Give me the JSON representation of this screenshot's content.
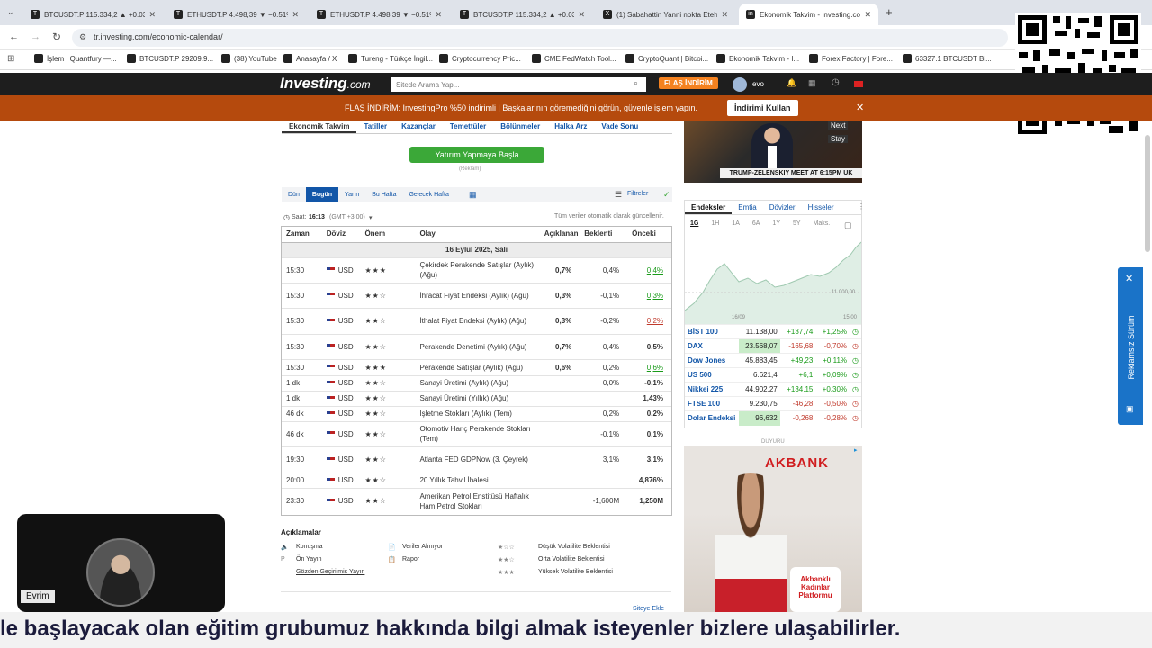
{
  "browser": {
    "tabs": [
      {
        "label": "BTCUSDT.P 115.334,2 ▲ +0.03%"
      },
      {
        "label": "ETHUSDT.P 4.498,39 ▼ −0.51%"
      },
      {
        "label": "ETHUSDT.P 4.498,39 ▼ −0.51%"
      },
      {
        "label": "BTCUSDT.P 115.334,2 ▲ +0.03%"
      },
      {
        "label": "(1) Sabahattin Yanni nokta Eteh"
      },
      {
        "label": "Ekonomik Takvim - Investing.com"
      }
    ],
    "new_tab": "+",
    "url": "tr.investing.com/economic-calendar/",
    "bookmarks": [
      "İşlem | Quantfury —...",
      "BTCUSDT.P 29209.9...",
      "(38) YouTube",
      "Anasayfa / X",
      "Tureng - Türkçe İngil...",
      "Cryptocurrency Pric...",
      "CME FedWatch Tool...",
      "CryptoQuant | Bitcoi...",
      "Ekonomik Takvim - I...",
      "Forex Factory | Fore...",
      "63327.1 BTCUSDT Bi..."
    ]
  },
  "site": {
    "logo": "Investing",
    "logo_suffix": ".com",
    "search_placeholder": "Sitede Arama Yap...",
    "flash_button": "FLAŞ İNDİRİM",
    "user": "evo",
    "promo_text": "FLAŞ İNDİRİM: InvestingPro %50 indirimli | Başkalarının göremediğini görün, güvenle işlem yapın.",
    "promo_button": "İndirimi Kullan",
    "tabs": [
      "Ekonomik Takvim",
      "Tatiller",
      "Kazançlar",
      "Temettüler",
      "Bölünmeler",
      "Halka Arz",
      "Vade Sonu"
    ],
    "invest_button": "Yatırım Yapmaya Başla",
    "ad_label": "(Reklam)",
    "day_tabs": [
      "Dün",
      "Bugün",
      "Yarın",
      "Bu Hafta",
      "Gelecek Hafta"
    ],
    "filters": "Filtreler",
    "time_label": "Saat:",
    "time_value": "16:13",
    "timezone": "(GMT +3:00)",
    "auto_update": "Tüm veriler otomatik olarak güncellenir.",
    "columns": [
      "Zaman",
      "Döviz",
      "Önem",
      "Olay",
      "Açıklanan",
      "Beklenti",
      "Önceki"
    ],
    "date_row": "16 Eylül 2025, Salı",
    "events": [
      {
        "time": "15:30",
        "cur": "USD",
        "stars": 3,
        "event": "Çekirdek Perakende Satışlar (Aylık) (Ağu)",
        "actual": "0,7%",
        "actual_cls": "grn",
        "forecast": "0,4%",
        "previous": "0,4%",
        "prev_cls": "grn",
        "h": 28
      },
      {
        "time": "15:30",
        "cur": "USD",
        "stars": 2,
        "event": "İhracat Fiyat Endeksi (Aylık) (Ağu)",
        "actual": "0,3%",
        "actual_cls": "grn",
        "forecast": "-0,1%",
        "previous": "0,3%",
        "prev_cls": "grn",
        "h": 28
      },
      {
        "time": "15:30",
        "cur": "USD",
        "stars": 2,
        "event": "İthalat Fiyat Endeksi (Aylık) (Ağu)",
        "actual": "0,3%",
        "actual_cls": "grn",
        "forecast": "-0,2%",
        "previous": "0,2%",
        "prev_cls": "red",
        "h": 29
      },
      {
        "time": "15:30",
        "cur": "USD",
        "stars": 2,
        "event": "Perakende Denetimi (Aylık) (Ağu)",
        "actual": "0,7%",
        "actual_cls": "grn",
        "forecast": "0,4%",
        "previous": "0,5%",
        "prev_cls": "",
        "h": 28
      },
      {
        "time": "15:30",
        "cur": "USD",
        "stars": 3,
        "event": "Perakende Satışlar (Aylık) (Ağu)",
        "actual": "0,6%",
        "actual_cls": "grn",
        "forecast": "0,2%",
        "previous": "0,6%",
        "prev_cls": "grn",
        "h": 18
      },
      {
        "time": "1 dk",
        "cur": "USD",
        "stars": 2,
        "event": "Sanayi Üretimi (Aylık) (Ağu)",
        "actual": "",
        "actual_cls": "",
        "forecast": "0,0%",
        "previous": "-0,1%",
        "prev_cls": "",
        "h": 17
      },
      {
        "time": "1 dk",
        "cur": "USD",
        "stars": 2,
        "event": "Sanayi Üretimi (Yıllık) (Ağu)",
        "actual": "",
        "actual_cls": "",
        "forecast": "",
        "previous": "1,43%",
        "prev_cls": "",
        "h": 17
      },
      {
        "time": "46 dk",
        "cur": "USD",
        "stars": 2,
        "event": "İşletme Stokları (Aylık) (Tem)",
        "actual": "",
        "actual_cls": "",
        "forecast": "0,2%",
        "previous": "0,2%",
        "prev_cls": "",
        "h": 17
      },
      {
        "time": "46 dk",
        "cur": "USD",
        "stars": 2,
        "event": "Otomotiv Hariç Perakende Stokları (Tem)",
        "actual": "",
        "actual_cls": "",
        "forecast": "-0,1%",
        "previous": "0,1%",
        "prev_cls": "",
        "h": 28
      },
      {
        "time": "19:30",
        "cur": "USD",
        "stars": 2,
        "event": "Atlanta FED GDPNow (3. Çeyrek)",
        "actual": "",
        "actual_cls": "",
        "forecast": "3,1%",
        "previous": "3,1%",
        "prev_cls": "",
        "h": 29
      },
      {
        "time": "20:00",
        "cur": "USD",
        "stars": 2,
        "event": "20 Yıllık Tahvil İhalesi",
        "actual": "",
        "actual_cls": "",
        "forecast": "",
        "previous": "4,876%",
        "prev_cls": "",
        "h": 17
      },
      {
        "time": "23:30",
        "cur": "USD",
        "stars": 2,
        "event": "Amerikan Petrol Enstitüsü Haftalık Ham Petrol Stokları",
        "actual": "",
        "actual_cls": "",
        "forecast": "-1,600M",
        "previous": "1,250M",
        "prev_cls": "",
        "h": 29
      }
    ],
    "notes_title": "Açıklamalar",
    "legend": [
      {
        "icon": "🔈",
        "text": "Konuşma"
      },
      {
        "icon": "P",
        "text": "Ön Yayın"
      },
      {
        "icon": "",
        "text": "Gözden Geçirilmiş Yayın"
      },
      {
        "icon": "📄",
        "text": "Veriler Alınıyor"
      },
      {
        "icon": "📋",
        "text": "Rapor"
      },
      {
        "icon": "★☆☆",
        "text": "Düşük Volatilite Beklentisi"
      },
      {
        "icon": "★★☆",
        "text": "Orta Volatilite Beklentisi"
      },
      {
        "icon": "★★★",
        "text": "Yüksek Volatilite Beklentisi"
      }
    ],
    "add_site": "Siteye Ekle"
  },
  "news": {
    "headline": "TRUMP-ZELENSKIY MEET AT 6:15PM UK",
    "next": "Next",
    "stay": "Stay"
  },
  "markets": {
    "tabs": [
      "Endeksler",
      "Emtia",
      "Dövizler",
      "Hisseler"
    ],
    "periods": [
      "1G",
      "1H",
      "1A",
      "6A",
      "1Y",
      "5Y",
      "Maks."
    ],
    "chart_label": "11.000,00",
    "x_labels": [
      "16/09",
      "15:00"
    ],
    "rows": [
      {
        "name": "BİST 100",
        "last": "11.138,00",
        "chg": "+137,74",
        "pct": "+1,25%",
        "up": true
      },
      {
        "name": "DAX",
        "last": "23.568,07",
        "chg": "-165,68",
        "pct": "-0,70%",
        "up": false
      },
      {
        "name": "Dow Jones",
        "last": "45.883,45",
        "chg": "+49,23",
        "pct": "+0,11%",
        "up": true
      },
      {
        "name": "US 500",
        "last": "6.621,4",
        "chg": "+6,1",
        "pct": "+0,09%",
        "up": true
      },
      {
        "name": "Nikkei 225",
        "last": "44.902,27",
        "chg": "+134,15",
        "pct": "+0,30%",
        "up": true
      },
      {
        "name": "FTSE 100",
        "last": "9.230,75",
        "chg": "-46,28",
        "pct": "-0,50%",
        "up": false
      },
      {
        "name": "Dolar Endeksi",
        "last": "96,632",
        "chg": "-0,268",
        "pct": "-0,28%",
        "up": false
      }
    ]
  },
  "ad": {
    "label": "DUYURU",
    "brand": "AKBANK",
    "badge1": "Akbanklı",
    "badge2": "Kadınlar",
    "badge3": "Platformu"
  },
  "side_ad": "Reklamsız Sürüm",
  "webcam": {
    "name": "Evrim"
  },
  "subtitle": "le başlayacak olan eğitim grubumuz hakkında bilgi almak isteyenler bizlere ulaşabilirler."
}
